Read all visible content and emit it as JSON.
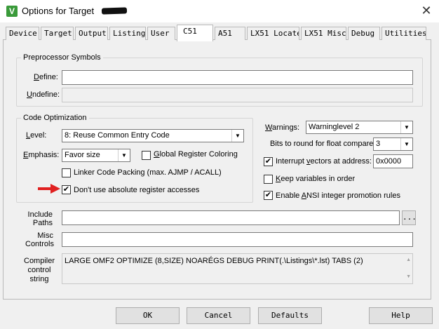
{
  "window": {
    "title": "Options for Target",
    "close_glyph": "✕",
    "icon_glyph": "V"
  },
  "tabs": [
    {
      "label": "Device"
    },
    {
      "label": "Target"
    },
    {
      "label": "Output"
    },
    {
      "label": "Listing"
    },
    {
      "label": "User"
    },
    {
      "label": "C51"
    },
    {
      "label": "A51"
    },
    {
      "label": "LX51 Locate"
    },
    {
      "label": "LX51 Misc"
    },
    {
      "label": "Debug"
    },
    {
      "label": "Utilities"
    }
  ],
  "active_tab": "C51",
  "preprocessor": {
    "title": "Preprocessor Symbols",
    "define_label_u": "D",
    "define_label_rest": "efine:",
    "define_value": "",
    "undefine_label_u": "U",
    "undefine_label_rest": "ndefine:",
    "undefine_value": ""
  },
  "optimization": {
    "title": "Code Optimization",
    "level_label_u": "L",
    "level_label_rest": "evel:",
    "level_value": "8: Reuse Common Entry Code",
    "emphasis_label_u": "E",
    "emphasis_label_rest": "mphasis:",
    "emphasis_value": "Favor size",
    "global_reg_label_u": "G",
    "global_reg_label_rest": "lobal Register Coloring",
    "global_reg_checked": false,
    "linker_packing_label": "Linker Code Packing (max. AJMP / ACALL)",
    "linker_packing_checked": false,
    "no_abs_reg_label": "Don't use absolute register accesses",
    "no_abs_reg_checked": true
  },
  "right": {
    "warnings_label_u": "W",
    "warnings_label_rest": "arnings:",
    "warnings_value": "Warninglevel 2",
    "bits_round_label": "Bits to round for float compare:",
    "bits_round_value": "3",
    "interrupt_label_pre": "Interrupt ",
    "interrupt_label_u": "v",
    "interrupt_label_rest": "ectors at address:",
    "interrupt_checked": true,
    "interrupt_value": "0x0000",
    "keep_vars_label_u": "K",
    "keep_vars_label_rest": "eep variables in order",
    "keep_vars_checked": false,
    "ansi_label_pre": "Enable ",
    "ansi_label_u": "A",
    "ansi_label_rest": "NSI integer promotion rules",
    "ansi_checked": true
  },
  "include": {
    "label_line1": "Include",
    "label_line2": "Paths",
    "value": "",
    "browse_label": "..."
  },
  "misc": {
    "label_line1": "Misc",
    "label_line2": "Controls",
    "value": ""
  },
  "compiler": {
    "label_line1": "Compiler",
    "label_line2": "control",
    "label_line3": "string",
    "value": "LARGE OMF2 OPTIMIZE (8,SIZE) NOARÉGS DEBUG PRINT(.\\Listings\\*.lst) TABS (2)"
  },
  "buttons": {
    "ok": "OK",
    "cancel": "Cancel",
    "defaults": "Defaults",
    "help": "Help"
  },
  "colors": {
    "annotation_arrow": "#e02020",
    "app_icon": "#3a9a3a"
  }
}
